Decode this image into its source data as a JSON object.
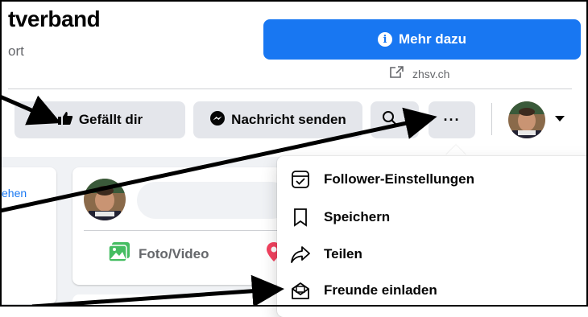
{
  "page": {
    "title": "tverband",
    "subtitle": "ort"
  },
  "actions": {
    "mehr_dazu": "Mehr dazu",
    "website": "zhsv.ch",
    "like_label": "Gefällt dir",
    "message_label": "Nachricht senden",
    "more_label": "···"
  },
  "sidebar": {
    "link_fragment": "ehen"
  },
  "composer": {
    "photo_video": "Foto/Video"
  },
  "menu": {
    "items": [
      {
        "label": "Follower-Einstellungen",
        "icon": "follow-settings-icon"
      },
      {
        "label": "Speichern",
        "icon": "bookmark-icon"
      },
      {
        "label": "Teilen",
        "icon": "share-icon"
      },
      {
        "label": "Freunde einladen",
        "icon": "invite-friends-icon"
      }
    ]
  },
  "colors": {
    "primary_blue": "#1877f2",
    "button_gray": "#e4e6eb",
    "annotation_arrow": "#000000"
  }
}
